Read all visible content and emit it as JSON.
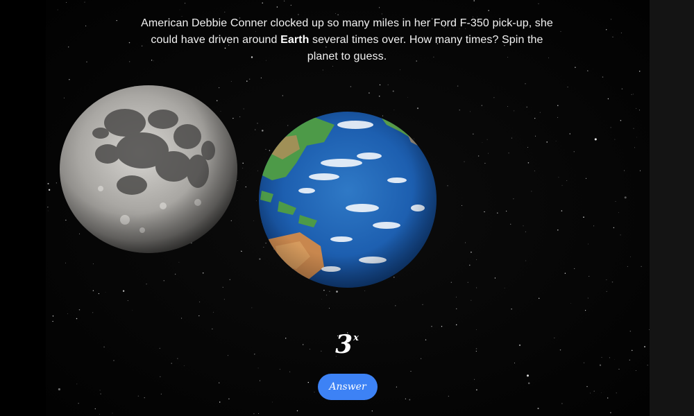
{
  "quiz": {
    "question_part1": "American Debbie Conner clocked up so many miles in her Ford F-350 pick-up, she could have driven around",
    "question_bold": "Earth",
    "question_part2": "several times over. How many times? Spin the planet to guess.",
    "guess_value": "3",
    "guess_suffix": "x",
    "answer_label": "Answer"
  },
  "objects": {
    "moon": "moon-image",
    "earth": "earth-globe"
  },
  "colors": {
    "background": "#000000",
    "right_panel": "#141414",
    "answer_button": "#3d82f5",
    "text": "#f2f2f2"
  }
}
